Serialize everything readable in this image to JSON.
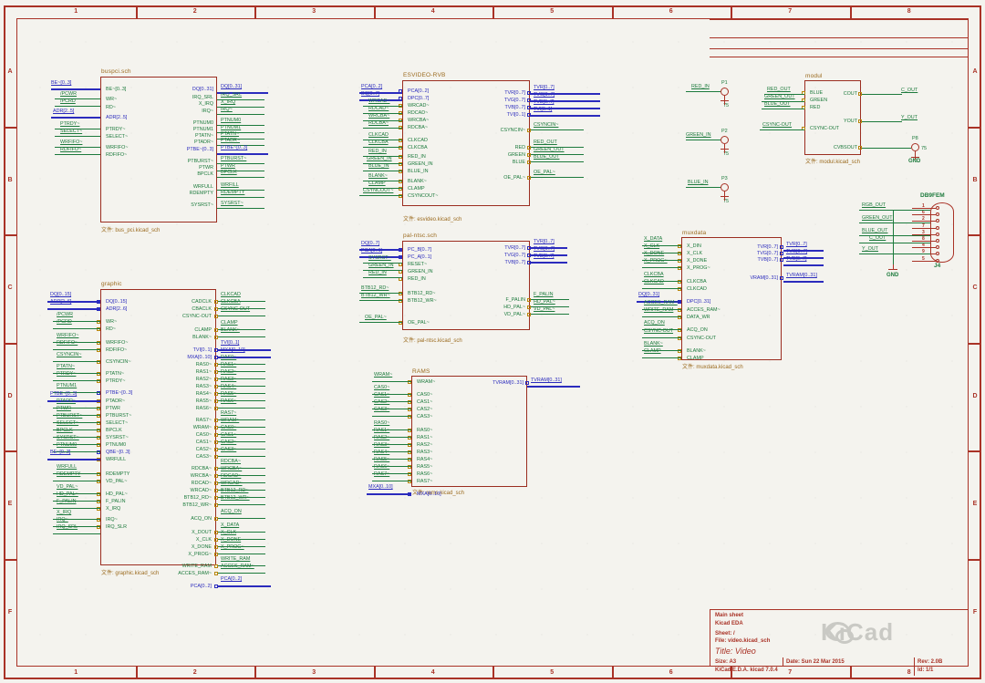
{
  "frame": {
    "column_labels": [
      "1",
      "2",
      "3",
      "4",
      "5",
      "6",
      "7",
      "8"
    ],
    "row_labels": [
      "A",
      "B",
      "C",
      "D",
      "E",
      "F"
    ]
  },
  "title_block": {
    "comment1": "Main sheet",
    "comment2": "Kicad EDA",
    "sheet": "Sheet: /",
    "file": "File: video.kicad_sch",
    "title": "Title: Video",
    "size": "Size: A3",
    "date": "Date: Sun 22 Mar 2015",
    "rev": "Rev: 2.0B",
    "tool": "KiCad E.D.A.  kicad 7.0.4",
    "id": "Id: 1/1"
  },
  "watermark": {
    "text": "KiCad"
  },
  "sheets": [
    {
      "name": "buspci.sch",
      "file": "文件: bus_pci.kicad_sch",
      "inputs": [
        "BE~[0..3]",
        "WR~",
        "RD~",
        "ADR[2..5]",
        "PTRDY~",
        "SELECT~",
        "WRFIFO~",
        "RDFIFO~"
      ],
      "outputs": [
        "DQ[0..31]",
        "IRQ_SRL",
        "X_IRQ",
        "IRQ~",
        "PTNUM0",
        "PTNUM1",
        "PTATN~",
        "PTADR~",
        "PTBE~[0..3]",
        "PTBURST~",
        "PTWR",
        "BPCLK",
        "WRFULL",
        "RDEMPTY",
        "SYSRST~"
      ]
    },
    {
      "name": "graphic",
      "file": "文件: graphic.kicad_sch",
      "inputs": [
        "DQ[0..15]",
        "ADR[2..6]",
        "WR~",
        "RD~",
        "WRFIFO~",
        "RDFIFO~",
        "CSYNCIN~",
        "PTATN~",
        "PTRDY~",
        "PTBE~[0..3]",
        "PTADR~",
        "PTWR",
        "PTBURST~",
        "SELECT~",
        "BPCLK",
        "SYSRST~",
        "PTNUM0",
        "QBE~[0..3]",
        "WRFULL",
        "RDEMPTY",
        "VD_PAL~",
        "HD_PAL~",
        "F_PALIN",
        "X_IRQ",
        "IRQ~",
        "IRQ_SLR"
      ],
      "outputs": [
        "CADCLK",
        "CBACLK",
        "CSYNC-OUT",
        "CLAMP",
        "BLANK~",
        "TVI[0..1]",
        "MXA[0..10]",
        "RAS0~",
        "RAS1~",
        "RAS2~",
        "RAS3~",
        "RAS4~",
        "RAS5~",
        "RAS6~",
        "RAS7~",
        "WRAM~",
        "CAS0~",
        "CAS1~",
        "CAS2~",
        "CAS3~",
        "RDCBA~",
        "WRCBA~",
        "RDCAD~",
        "WRCAD~",
        "BTB12_RD~",
        "BTB12_WR~",
        "ACQ_ON",
        "X_DOUT",
        "X_CLK",
        "X_DONE",
        "X_PROG~",
        "WRITE_RAM",
        "ACCES_RAM~",
        "PCA[0..2]"
      ]
    },
    {
      "name": "ESVIDEO-RVB",
      "file": "文件: esvideo.kicad_sch",
      "inputs": [
        "PCA[0..2]",
        "DPC[0..7]",
        "WRCAD~",
        "RDCAD~",
        "WRCBA~",
        "RDCBA~",
        "CLKCAD",
        "CLKCBA",
        "RED_IN",
        "GREEN_IN",
        "BLUE_IN",
        "BLANK~",
        "CLAMP",
        "CSYNCOUT~"
      ],
      "outputs": [
        "TVR[0..7]",
        "TVG[0..7]",
        "TVB[0..7]",
        "TVI[0..1]",
        "CSYNCIN~",
        "RED",
        "GREEN",
        "BLUE",
        "OE_PAL~"
      ]
    },
    {
      "name": "pal-ntsc.sch",
      "file": "文件: pal-ntsc.kicad_sch",
      "inputs": [
        "PC_B[0..7]",
        "PC_A[0..1]",
        "RESET~",
        "GREEN_IN",
        "RED_IN",
        "BTB12_RD~",
        "BTB12_WR~",
        "OE_PAL~"
      ],
      "outputs": [
        "TVR[0..7]",
        "TVG[0..7]",
        "TVB[0..7]",
        "F_PALIN",
        "HD_PAL~",
        "VD_PAL~"
      ]
    },
    {
      "name": "RAMS",
      "file": "文件: rams.kicad_sch",
      "inputs": [
        "WRAM~",
        "CAS0~",
        "CAS1~",
        "CAS2~",
        "CAS3~",
        "RAS0~",
        "RAS1~",
        "RAS2~",
        "RAS3~",
        "RAS4~",
        "RAS5~",
        "RAS6~",
        "RAS7~",
        "MXA[0..10]"
      ],
      "outputs": [
        "TVRAM[0..31]"
      ]
    },
    {
      "name": "muxdata",
      "file": "文件: muxdata.kicad_sch",
      "inputs": [
        "X_DIN",
        "X_CLK",
        "X_DONE",
        "X_PROG~",
        "CLKCBA",
        "CLKCAD",
        "DPC[0..31]",
        "ACCES_RAM~",
        "DATA_WR",
        "ACQ_ON",
        "CSYNC-OUT",
        "BLANK~",
        "CLAMP"
      ],
      "outputs": [
        "TVR[0..7]",
        "TVG[0..7]",
        "TVB[0..7]",
        "VRAM[0..31]"
      ]
    },
    {
      "name": "modul",
      "file": "文件: modul.kicad_sch",
      "inputs": [
        "BLUE",
        "GREEN",
        "RED",
        "CSYNC-OUT"
      ],
      "outputs": [
        "COUT",
        "YOUT",
        "CVBSOUT"
      ]
    }
  ],
  "left_labels_buspci": [
    "BE~[0..3]",
    "/PCWR",
    "/PCRD",
    "ADR[2..5]",
    "PTRDY~",
    "SELECT~",
    "WRFIFO~",
    "RDFIFO~"
  ],
  "right_labels_buspci": [
    "DQ[0..31]",
    "IRQ_SRL",
    "X_IRQ",
    "IRQ~",
    "PTNUM0",
    "PTNUM1",
    "PTATN~",
    "PTADR~",
    "PTBE~[0..3]",
    "PTBURST~",
    "PTWR",
    "BPCLK",
    "WRFILL",
    "RDEMPTY",
    "SYSRST~"
  ],
  "left_labels_graphic": [
    "DQ[0..15]",
    "ADR[2..6]",
    "/PCWR",
    "/PCRD",
    "WRFIFO~",
    "RDFIFO~",
    "CSYNCIN~",
    "PTATN~",
    "PTRDY~",
    "PTNUM1",
    "PTBE~[0..3]",
    "PTADR~",
    "PTWR",
    "PTBURST~",
    "SELECT~",
    "BPCLK",
    "SYSRST~",
    "PTNUM0",
    "BE~[0..3]",
    "WRFULL",
    "RDEMPTY",
    "VD_PAL~",
    "HD_PAL~",
    "F_PALIN",
    "X_IRQ",
    "IRQ~",
    "IRQ_SRL"
  ],
  "right_labels_graphic": [
    "CLKCAD",
    "CLKCBA",
    "CSYNC-OUT",
    "CLAMP",
    "BLANK~",
    "TVI[0..1]",
    "MXA[0..10]",
    "RAS0~",
    "RAS1~",
    "RAS2~",
    "RAS3~",
    "RAS4~",
    "RAS5~",
    "RAS6~",
    "RAS7~",
    "WRAM~",
    "CAS0~",
    "CAS1~",
    "CAS2~",
    "CAS3~",
    "RDCBA~",
    "WRCBA~",
    "RDCAD~",
    "WRCAD~",
    "BTB12_RD~",
    "BTB12_WR~",
    "ACQ_ON",
    "X_DATA",
    "X_CLK",
    "X_DONE",
    "X_PROG~",
    "WRITE_RAM",
    "ACCES_RAM~",
    "PCA[0..2]"
  ],
  "components": [
    {
      "ref": "P1",
      "label": "RED_IN",
      "value": "75"
    },
    {
      "ref": "P2",
      "label": "GREEN_IN",
      "value": "75"
    },
    {
      "ref": "P3",
      "label": "BLUE_IN",
      "value": "75"
    },
    {
      "ref": "P8",
      "label": "CVBSOUT",
      "value": "75",
      "gnd": "GND"
    }
  ],
  "connector": {
    "title": "DB9FEM",
    "ref": "J4",
    "gnd": "GND",
    "pins": [
      "1",
      "6",
      "2",
      "7",
      "3",
      "8",
      "4",
      "9",
      "5"
    ],
    "nets": [
      "RGB_OUT",
      "GREEN_OUT",
      "BLUE_OUT",
      "C_OUT",
      "Y_OUT"
    ]
  },
  "right_nets": [
    "C_OUT",
    "Y_OUT",
    "TVRAM[0..31]",
    "TVR[0..7]",
    "TVG[0..7]",
    "TVB[0..7]"
  ],
  "colors": {
    "frame": "#a93226",
    "sheet_border": "#9b2d20",
    "wire": "#1c7a3c",
    "bus": "#2b2bbd",
    "sheetname": "#9b6b1f",
    "background": "#f4f3ee"
  }
}
